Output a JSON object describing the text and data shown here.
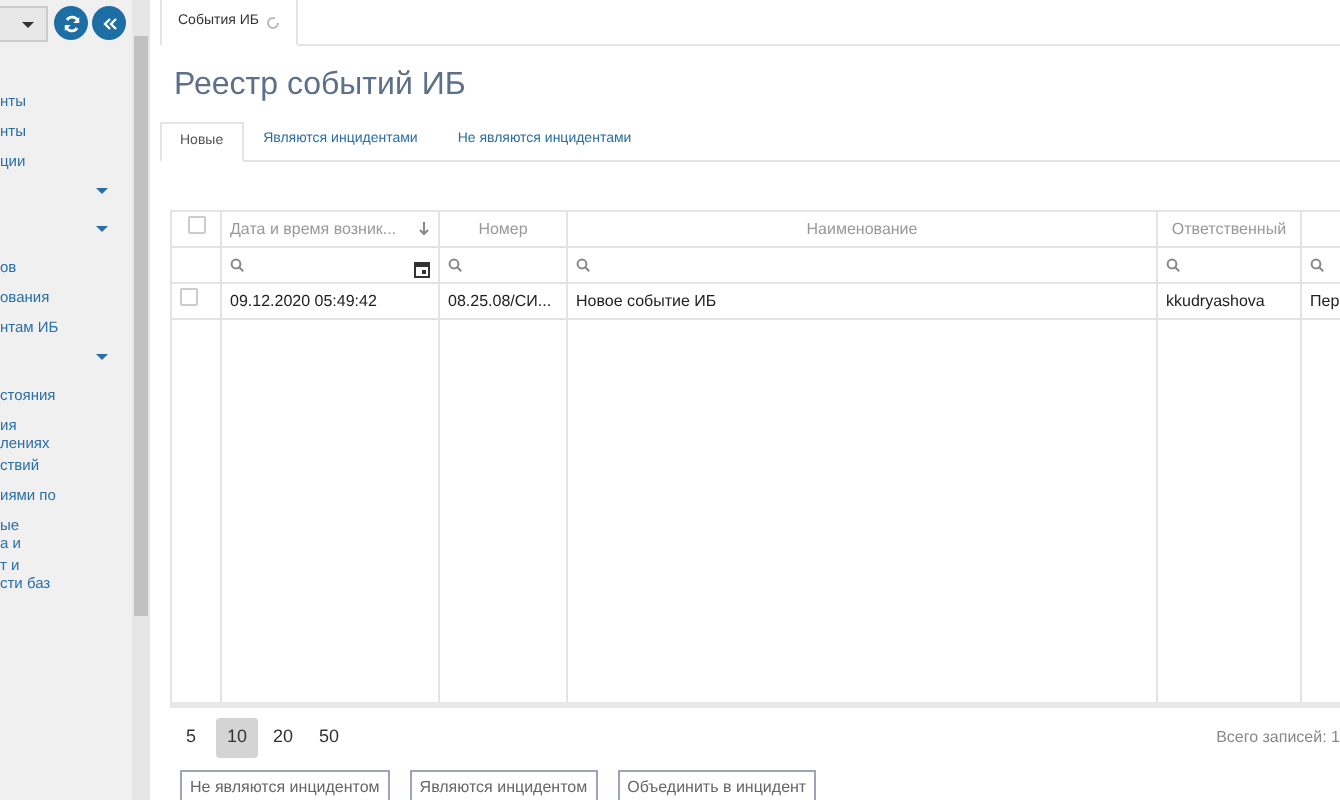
{
  "sidebar": {
    "items": [
      {
        "label": "нты",
        "kind": "link"
      },
      {
        "label": "нты",
        "kind": "link"
      },
      {
        "label": "ции",
        "kind": "link"
      },
      {
        "kind": "group"
      },
      {
        "kind": "group"
      },
      {
        "label": "ов",
        "kind": "link"
      },
      {
        "label": "ования",
        "kind": "link"
      },
      {
        "label": "нтам ИБ",
        "kind": "link"
      },
      {
        "kind": "group"
      },
      {
        "label": "стояния",
        "kind": "link"
      },
      {
        "label": "ия\nлениях",
        "kind": "link"
      },
      {
        "label": "ствий",
        "kind": "link"
      },
      {
        "label": "иями по",
        "kind": "link"
      },
      {
        "label": "ые\nа и",
        "kind": "link"
      },
      {
        "label": "т и\nсти баз",
        "kind": "link"
      }
    ]
  },
  "doc_tabs": [
    {
      "label": "События ИБ",
      "selected": true
    }
  ],
  "title": "Реестр событий ИБ",
  "tabs": [
    {
      "label": "Новые",
      "selected": true
    },
    {
      "label": "Являются инцидентами",
      "selected": false
    },
    {
      "label": "Не являются инцидентами",
      "selected": false
    }
  ],
  "table": {
    "all_checked": false,
    "columns": [
      {
        "label": "Дата и время возник...",
        "sorted": true,
        "kind": "date"
      },
      {
        "label": "Номер",
        "sorted": false,
        "kind": "text"
      },
      {
        "label": "Наименование",
        "sorted": false,
        "kind": "text"
      },
      {
        "label": "Ответственный",
        "sorted": false,
        "kind": "text"
      },
      {
        "sorted": false,
        "kind": "text"
      }
    ],
    "rows": [
      {
        "checked": false,
        "cells": [
          "09.12.2020 05:49:42",
          "08.25.08/СИ...",
          "Новое событие ИБ",
          "kkudryashova",
          "Пер"
        ]
      }
    ]
  },
  "page_sizes": [
    {
      "label": "5",
      "selected": false
    },
    {
      "label": "10",
      "selected": true
    },
    {
      "label": "20",
      "selected": false
    },
    {
      "label": "50",
      "selected": false
    }
  ],
  "total": "Всего записей: 1",
  "buttons": [
    "Не являются инцидентом",
    "Являются инцидентом",
    "Объединить в инцидент"
  ]
}
